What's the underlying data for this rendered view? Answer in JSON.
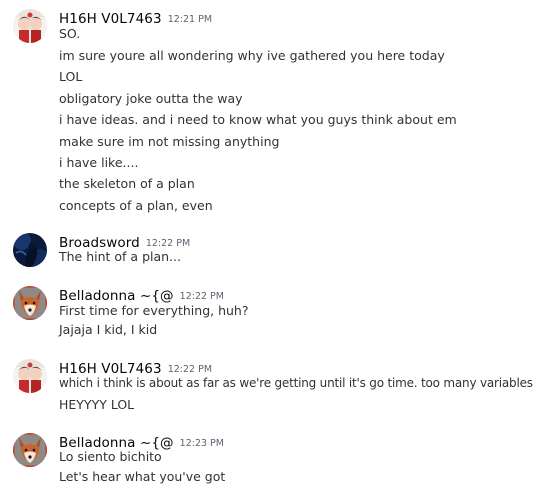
{
  "messages": [
    {
      "author": "H16H V0L7463",
      "time": "12:21 PM",
      "avatar": "anime-girls-avatar",
      "lines": [
        "SO.",
        "im sure youre all wondering why ive gathered you here today",
        "LOL",
        "obligatory joke outta the way",
        "i have ideas. and i need to know what you guys think about em",
        "make sure im not missing anything",
        "i have like....",
        "the skeleton of a plan",
        "concepts of a plan, even"
      ]
    },
    {
      "author": "Broadsword",
      "time": "12:22 PM",
      "avatar": "dark-blue-figure-avatar",
      "lines": [
        "The hint of a plan..."
      ]
    },
    {
      "author": "Belladonna ~{@",
      "time": "12:22 PM",
      "avatar": "fox-avatar",
      "lines": [
        "First time for everything, huh?",
        "Jajaja I kid, I kid"
      ]
    },
    {
      "author": "H16H V0L7463",
      "time": "12:22 PM",
      "avatar": "anime-girls-avatar",
      "lines": [
        "which i think is about as far as we're getting until it's go time. too many variables",
        "HEYYYY LOL"
      ]
    },
    {
      "author": "Belladonna ~{@",
      "time": "12:23 PM",
      "avatar": "fox-avatar",
      "lines": [
        "Lo siento bichito",
        "Let's hear what you've got"
      ]
    }
  ]
}
